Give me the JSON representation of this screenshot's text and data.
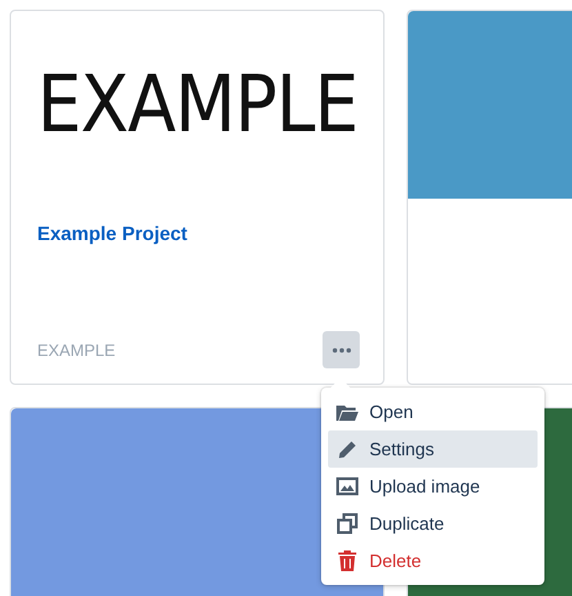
{
  "cards": [
    {
      "kind": "image",
      "thumbnail_text": "EXAMPLE",
      "title": "Example Project",
      "tag": "EXAMPLE",
      "menu_open": true
    },
    {
      "kind": "color",
      "color": "#4a99c6"
    },
    {
      "kind": "color",
      "color": "#7399e0"
    },
    {
      "kind": "color",
      "color": "#2d6a3e"
    }
  ],
  "menu": {
    "items": [
      {
        "kind": "folder",
        "label": "Open",
        "selected": false
      },
      {
        "kind": "pencil",
        "label": "Settings",
        "selected": true
      },
      {
        "kind": "image",
        "label": "Upload image",
        "selected": false
      },
      {
        "kind": "duplicate",
        "label": "Duplicate",
        "selected": false
      },
      {
        "kind": "trash",
        "label": "Delete",
        "selected": false
      }
    ]
  }
}
